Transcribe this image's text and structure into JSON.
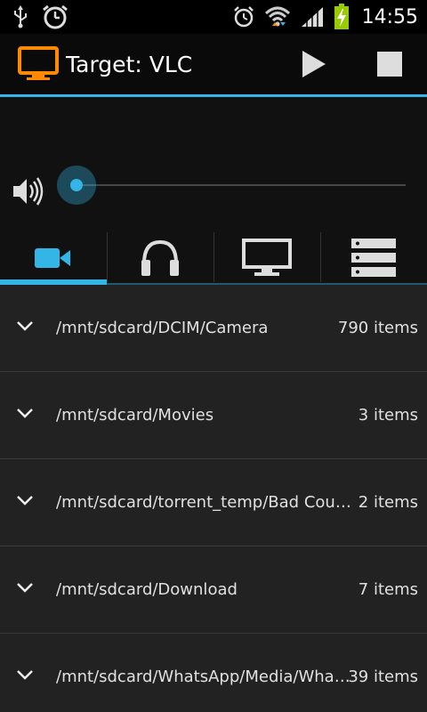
{
  "status_bar": {
    "time": "14:55",
    "left_icons": [
      "usb-icon",
      "alarm-clock-icon"
    ],
    "right_icons": [
      "alarm-icon",
      "wifi-icon",
      "signal-icon",
      "battery-charging-icon"
    ]
  },
  "action_bar": {
    "title": "Target: VLC",
    "app_icon": "monitor-icon",
    "actions": [
      "play-icon",
      "stop-icon"
    ]
  },
  "volume": {
    "level": 0.0
  },
  "tabs": [
    {
      "icon": "video-camera-icon",
      "active": true
    },
    {
      "icon": "headphones-icon",
      "active": false
    },
    {
      "icon": "monitor-icon",
      "active": false
    },
    {
      "icon": "list-icon",
      "active": false
    }
  ],
  "folders": [
    {
      "path": "/mnt/sdcard/DCIM/Camera",
      "count": "790 items"
    },
    {
      "path": "/mnt/sdcard/Movies",
      "count": "3 items"
    },
    {
      "path": "/mnt/sdcard/torrent_temp/Bad Count…",
      "count": "2 items"
    },
    {
      "path": "/mnt/sdcard/Download",
      "count": "7 items"
    },
    {
      "path": "/mnt/sdcard/WhatsApp/Media/Wha…",
      "count": "39 items"
    }
  ],
  "colors": {
    "accent": "#33b5e5",
    "app_icon": "#ff8a00",
    "list_bg": "#222222"
  }
}
